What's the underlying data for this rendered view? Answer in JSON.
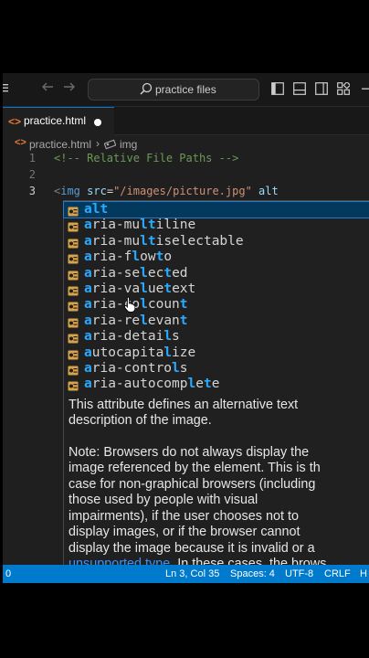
{
  "titlebar": {
    "search_placeholder": "practice files"
  },
  "tab": {
    "filename": "practice.html",
    "icon": "html-icon",
    "unsaved": true
  },
  "breadcrumb": {
    "file": "practice.html",
    "element": "img",
    "separator": "›"
  },
  "code": {
    "lines": [
      {
        "num": "1",
        "text": "<!-- Relative File Paths -->"
      },
      {
        "num": "2",
        "text": ""
      },
      {
        "num": "3",
        "tag_open": "<",
        "tag": "img",
        "attr": "src",
        "eq": "=",
        "value": "\"/images/picture.jpg\"",
        "typed": "alt"
      }
    ]
  },
  "suggestions": [
    {
      "label": "alt",
      "selected": true
    },
    {
      "label": "aria-multiline"
    },
    {
      "label": "aria-multiselectable"
    },
    {
      "label": "aria-flowto"
    },
    {
      "label": "aria-selected"
    },
    {
      "label": "aria-valuetext"
    },
    {
      "label": "aria-colcount"
    },
    {
      "label": "aria-relevant"
    },
    {
      "label": "aria-details"
    },
    {
      "label": "autocapitalize"
    },
    {
      "label": "aria-controls"
    },
    {
      "label": "aria-autocomplete"
    }
  ],
  "docs": {
    "description_lines": [
      "This attribute defines an alternative text",
      "description of the image."
    ],
    "note_lines": [
      "Note: Browsers do not always display the",
      "image referenced by the element. This is th",
      "case for non-graphical browsers (including",
      "those used by people with visual",
      "impairments), if the user chooses not to",
      "display images, or if the browser cannot",
      "display the image because it is invalid or a"
    ],
    "last_line_link": "unsupported type",
    "last_line_rest": ". In these cases, the brows"
  },
  "statusbar": {
    "left": "0",
    "position": "Ln 3, Col 35",
    "spaces": "Spaces: 4",
    "encoding": "UTF-8",
    "eol": "CRLF",
    "language": "H"
  },
  "colors": {
    "accent": "#007acc",
    "editor_bg": "#1f1f1f",
    "match_highlight": "#2aaaff"
  }
}
